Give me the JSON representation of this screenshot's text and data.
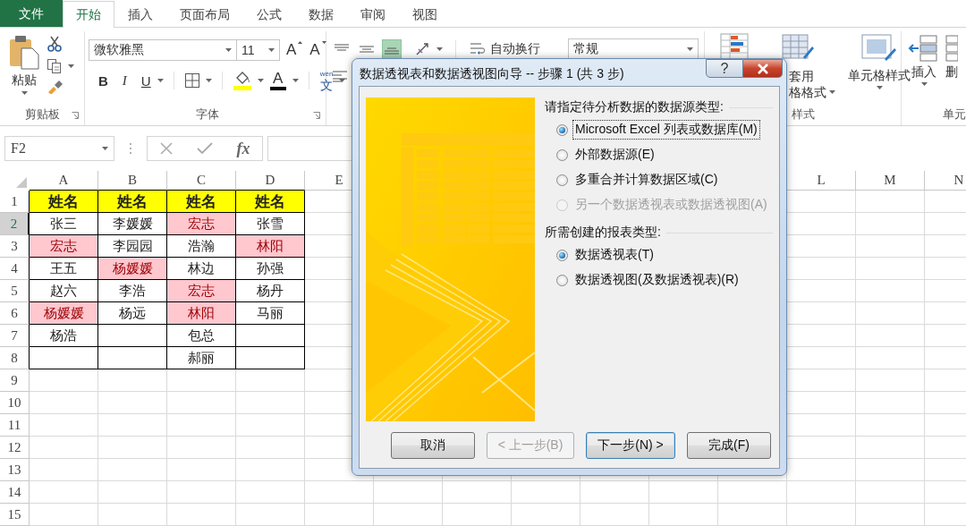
{
  "menu_tabs": [
    {
      "label": "文件",
      "kind": "file",
      "selected": false
    },
    {
      "label": "开始",
      "kind": "tab",
      "selected": true
    },
    {
      "label": "插入",
      "kind": "tab",
      "selected": false
    },
    {
      "label": "页面布局",
      "kind": "tab",
      "selected": false
    },
    {
      "label": "公式",
      "kind": "tab",
      "selected": false
    },
    {
      "label": "数据",
      "kind": "tab",
      "selected": false
    },
    {
      "label": "审阅",
      "kind": "tab",
      "selected": false
    },
    {
      "label": "视图",
      "kind": "tab",
      "selected": false
    }
  ],
  "ribbon": {
    "clipboard": {
      "paste": "粘贴",
      "label": "剪贴板"
    },
    "font": {
      "name": "微软雅黑",
      "size": "11",
      "grow": "A",
      "shrink": "A",
      "bold": "B",
      "italic": "I",
      "underline": "U",
      "color_letter": "A",
      "phonetic_top": "wén",
      "phonetic": "文",
      "label": "字体"
    },
    "alignment": {
      "buttons": [
        {
          "kind": "top",
          "selected": false
        },
        {
          "kind": "middle",
          "selected": false
        },
        {
          "kind": "bottom",
          "selected": true
        }
      ],
      "wrap": "自动换行"
    },
    "number": {
      "format": "常规"
    },
    "styles": {
      "table_lines": [
        "套用",
        "格格式"
      ],
      "cell_styles": "单元格样式",
      "label": "样式"
    },
    "cells": {
      "insert": "插入",
      "delete": "删",
      "label": "单元"
    }
  },
  "formula_bar": {
    "name_box": "F2",
    "function_button": "fx"
  },
  "sheet": {
    "columns_left": [
      "A",
      "B",
      "C",
      "D",
      "E"
    ],
    "columns_right": [
      "L",
      "M",
      "N"
    ],
    "rows": [
      {
        "label": "1",
        "selected": false,
        "kind": "header",
        "cells": [
          {
            "text": "姓名",
            "highlight": false
          },
          {
            "text": "姓名",
            "highlight": false
          },
          {
            "text": "姓名",
            "highlight": false
          },
          {
            "text": "姓名",
            "highlight": false
          }
        ]
      },
      {
        "label": "2",
        "selected": true,
        "kind": "data",
        "cells": [
          {
            "text": "张三",
            "highlight": false
          },
          {
            "text": "李媛媛",
            "highlight": false
          },
          {
            "text": "宏志",
            "highlight": true
          },
          {
            "text": "张雪",
            "highlight": false
          }
        ]
      },
      {
        "label": "3",
        "selected": false,
        "kind": "data",
        "cells": [
          {
            "text": "宏志",
            "highlight": true
          },
          {
            "text": "李园园",
            "highlight": false
          },
          {
            "text": "浩瀚",
            "highlight": false
          },
          {
            "text": "林阳",
            "highlight": true
          }
        ]
      },
      {
        "label": "4",
        "selected": false,
        "kind": "data",
        "cells": [
          {
            "text": "王五",
            "highlight": false
          },
          {
            "text": "杨媛媛",
            "highlight": true
          },
          {
            "text": "林边",
            "highlight": false
          },
          {
            "text": "孙强",
            "highlight": false
          }
        ]
      },
      {
        "label": "5",
        "selected": false,
        "kind": "data",
        "cells": [
          {
            "text": "赵六",
            "highlight": false
          },
          {
            "text": "李浩",
            "highlight": false
          },
          {
            "text": "宏志",
            "highlight": true
          },
          {
            "text": "杨丹",
            "highlight": false
          }
        ]
      },
      {
        "label": "6",
        "selected": false,
        "kind": "data",
        "cells": [
          {
            "text": "杨媛媛",
            "highlight": true
          },
          {
            "text": "杨远",
            "highlight": false
          },
          {
            "text": "林阳",
            "highlight": true
          },
          {
            "text": "马丽",
            "highlight": false
          }
        ]
      },
      {
        "label": "7",
        "selected": false,
        "kind": "data",
        "cells": [
          {
            "text": "杨浩",
            "highlight": false
          },
          {
            "highlight": false
          },
          {
            "text": "包总",
            "highlight": false
          },
          {
            "highlight": false
          }
        ]
      },
      {
        "label": "8",
        "selected": false,
        "kind": "data",
        "cells": [
          {
            "highlight": false
          },
          {
            "highlight": false
          },
          {
            "text": "郝丽",
            "highlight": false
          },
          {
            "highlight": false
          }
        ]
      },
      {
        "label": "9",
        "selected": false,
        "kind": "plain"
      },
      {
        "label": "10",
        "selected": false,
        "kind": "plain"
      },
      {
        "label": "11",
        "selected": false,
        "kind": "plain"
      },
      {
        "label": "12",
        "selected": false,
        "kind": "plain"
      },
      {
        "label": "13",
        "selected": false,
        "kind": "plain"
      },
      {
        "label": "14",
        "selected": false,
        "kind": "plain"
      },
      {
        "label": "15",
        "selected": false,
        "kind": "plain"
      }
    ]
  },
  "dialog": {
    "title": "数据透视表和数据透视图向导 -- 步骤 1 (共 3 步)",
    "help": "?",
    "sections": [
      {
        "label": "请指定待分析数据的数据源类型:",
        "options": [
          {
            "label": "Microsoft Excel 列表或数据库(M)",
            "selected": true,
            "disabled": false,
            "focused": true
          },
          {
            "label": "外部数据源(E)",
            "selected": false,
            "disabled": false,
            "focused": false
          },
          {
            "label": "多重合并计算数据区域(C)",
            "selected": false,
            "disabled": false,
            "focused": false
          },
          {
            "label": "另一个数据透视表或数据透视图(A)",
            "selected": false,
            "disabled": true,
            "focused": false
          }
        ]
      },
      {
        "label": "所需创建的报表类型:",
        "options": [
          {
            "label": "数据透视表(T)",
            "selected": true,
            "disabled": false,
            "focused": false
          },
          {
            "label": "数据透视图(及数据透视表)(R)",
            "selected": false,
            "disabled": false,
            "focused": false
          }
        ]
      }
    ],
    "buttons": [
      {
        "label": "取消",
        "kind": "normal"
      },
      {
        "label": "< 上一步(B)",
        "kind": "disabled"
      },
      {
        "label": "下一步(N) >",
        "kind": "default"
      },
      {
        "label": "完成(F)",
        "kind": "normal"
      }
    ]
  }
}
